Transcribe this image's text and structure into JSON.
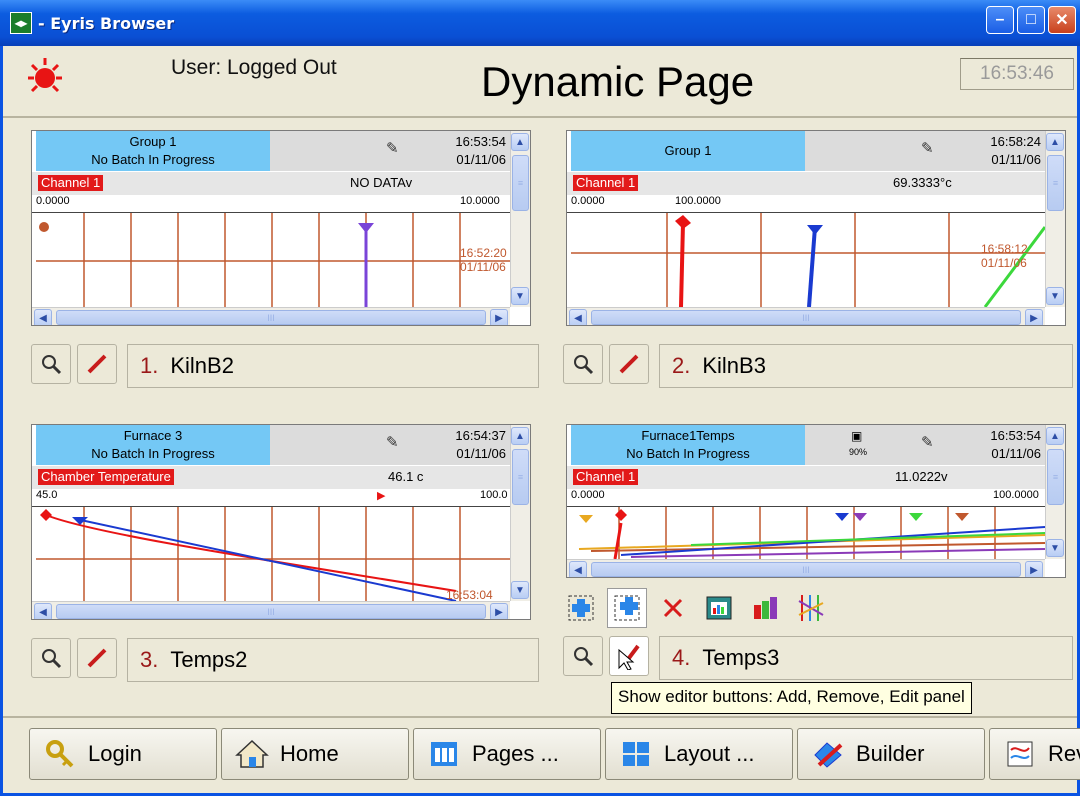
{
  "window": {
    "title": "- Eyris Browser"
  },
  "header": {
    "user": "User: Logged Out",
    "page_title": "Dynamic Page",
    "clock": "16:53:46"
  },
  "panels": [
    {
      "index": "1.",
      "name": "KilnB2",
      "group": [
        "Group 1",
        "No Batch In Progress"
      ],
      "time": "16:53:54",
      "date": "01/11/06",
      "channel": "Channel 1",
      "value": "NO DATAv",
      "scale_min": "0.0000",
      "scale_max": "10.0000",
      "plot_time": "16:52:20",
      "plot_date": "01/11/06"
    },
    {
      "index": "2.",
      "name": "KilnB3",
      "group": [
        "Group 1"
      ],
      "time": "16:58:24",
      "date": "01/11/06",
      "channel": "Channel 1",
      "value": "69.3333°c",
      "scale_min": "0.0000",
      "scale_max": "100.0000",
      "plot_time": "16:58:12",
      "plot_date": "01/11/06"
    },
    {
      "index": "3.",
      "name": "Temps2",
      "group": [
        "Furnace 3",
        "No Batch In Progress"
      ],
      "time": "16:54:37",
      "date": "01/11/06",
      "channel": "Chamber Temperature",
      "value": "46.1 c",
      "scale_min": "45.0",
      "scale_max": "100.0",
      "plot_time": "16:53:04"
    },
    {
      "index": "4.",
      "name": "Temps3",
      "group": [
        "Furnace1Temps",
        "No Batch In Progress"
      ],
      "time": "16:53:54",
      "date": "01/11/06",
      "battery": "90%",
      "channel": "Channel 1",
      "value": "11.0222v",
      "scale_min": "0.0000",
      "scale_max": "100.0000"
    }
  ],
  "tooltip": "Show editor buttons: Add, Remove, Edit panel",
  "footer": [
    "Login",
    "Home",
    "Pages ...",
    "Layout ...",
    "Builder",
    "Rev"
  ],
  "colors": {
    "accent_blue": "#74c8f5",
    "channel_red": "#e21a1a",
    "grid": "#c0582e",
    "name_number": "#9a1818"
  }
}
